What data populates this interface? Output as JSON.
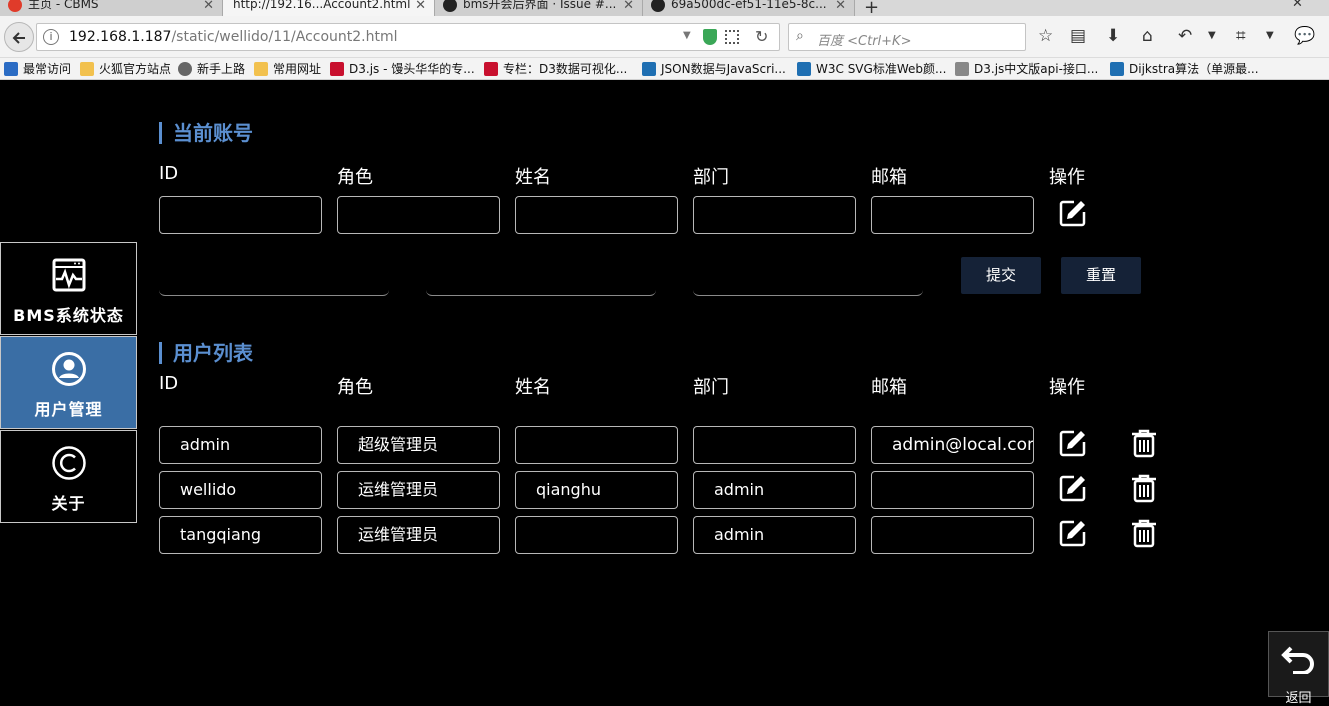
{
  "browser": {
    "tabs": [
      {
        "label": "主页 - CBMS"
      },
      {
        "label": "http://192.16...Account2.html"
      },
      {
        "label": "bms开会后界面 · Issue #..."
      },
      {
        "label": "69a500dc-ef51-11e5-8c..."
      }
    ],
    "url_host": "192.168.1.187",
    "url_path": "/static/wellido/11/Account2.html",
    "search_placeholder": "百度 <Ctrl+K>",
    "bookmarks": [
      {
        "label": "最常访问",
        "color": "#2b6cc4"
      },
      {
        "label": "火狐官方站点",
        "color": "#f2c14e"
      },
      {
        "label": "新手上路",
        "color": "#666666"
      },
      {
        "label": "常用网址",
        "color": "#f2c14e"
      },
      {
        "label": "D3.js - 馒头华华的专...",
        "color": "#c8102e"
      },
      {
        "label": "专栏：D3数据可视化...",
        "color": "#c8102e"
      },
      {
        "label": "JSON数据与JavaScri...",
        "color": "#1f6fb2"
      },
      {
        "label": "W3C SVG标准Web颜...",
        "color": "#1f6fb2"
      },
      {
        "label": "D3.js中文版api-接口...",
        "color": "#888888"
      },
      {
        "label": "Dijkstra算法（单源最...",
        "color": "#1f6fb2"
      }
    ]
  },
  "sidebar": {
    "items": [
      {
        "label": "BMS系统状态",
        "icon": "monitor-icon",
        "active": false
      },
      {
        "label": "用户管理",
        "icon": "user-icon",
        "active": true
      },
      {
        "label": "关于",
        "icon": "copyright-icon",
        "active": false
      }
    ]
  },
  "current_account": {
    "title": "当前账号",
    "headers": {
      "id": "ID",
      "role": "角色",
      "name": "姓名",
      "dept": "部门",
      "email": "邮箱",
      "action": "操作"
    },
    "submit_label": "提交",
    "reset_label": "重置"
  },
  "user_list": {
    "title": "用户列表",
    "headers": {
      "id": "ID",
      "role": "角色",
      "name": "姓名",
      "dept": "部门",
      "email": "邮箱",
      "action": "操作"
    },
    "rows": [
      {
        "id": "admin",
        "role": "超级管理员",
        "name": "",
        "dept": "",
        "email": "admin@local.com"
      },
      {
        "id": "wellido",
        "role": "运维管理员",
        "name": "qianghu",
        "dept": "admin",
        "email": ""
      },
      {
        "id": "tangqiang",
        "role": "运维管理员",
        "name": "",
        "dept": "admin",
        "email": ""
      }
    ]
  },
  "return_label": "返回",
  "colors": {
    "accent": "#5b8fd0",
    "active_sidebar": "#3a6ea5",
    "button_bg": "#152237"
  }
}
